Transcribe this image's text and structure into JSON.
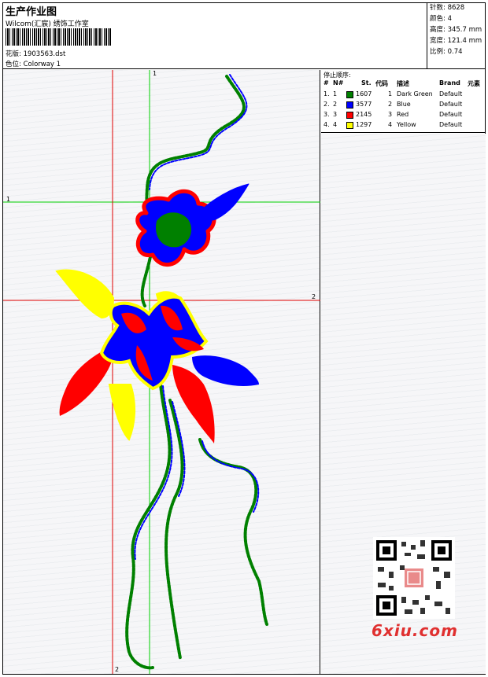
{
  "header": {
    "title": "生产作业图",
    "company": "Wilcom(汇宸) 绣饰工作室",
    "file_label": "花版:",
    "file_value": "1903563.dst",
    "color_label": "色位:",
    "color_value": "Colorway 1"
  },
  "stats": [
    {
      "label": "针数:",
      "value": "8628"
    },
    {
      "label": "颜色:",
      "value": "4"
    },
    {
      "label": "高度:",
      "value": "345.7 mm"
    },
    {
      "label": "宽度:",
      "value": "121.4 mm"
    },
    {
      "label": "比例:",
      "value": "0.74"
    }
  ],
  "stop_sequence": {
    "title": "停止顺序:",
    "columns": [
      "#",
      "N#",
      "St.",
      "代码",
      "描述",
      "Brand",
      "元素"
    ],
    "rows": [
      {
        "num": "1.",
        "n": "1",
        "stitches": "1607",
        "code": "1",
        "desc": "Dark Green",
        "brand": "Default",
        "color": "#008000"
      },
      {
        "num": "2.",
        "n": "2",
        "stitches": "3577",
        "code": "2",
        "desc": "Blue",
        "brand": "Default",
        "color": "#0000ff"
      },
      {
        "num": "3.",
        "n": "3",
        "stitches": "2145",
        "code": "3",
        "desc": "Red",
        "brand": "Default",
        "color": "#ff0000"
      },
      {
        "num": "4.",
        "n": "4",
        "stitches": "1297",
        "code": "4",
        "desc": "Yellow",
        "brand": "Default",
        "color": "#ffff00"
      }
    ]
  },
  "guides": {
    "green_v": "1",
    "green_h": "1",
    "red_h": "2",
    "red_v": "2"
  },
  "watermark": "6xiu.com",
  "colors": {
    "green": "#008000",
    "blue": "#0000ff",
    "red": "#ff0000",
    "yellow": "#ffff00",
    "guide_green": "#00d000",
    "guide_red": "#e00000"
  }
}
